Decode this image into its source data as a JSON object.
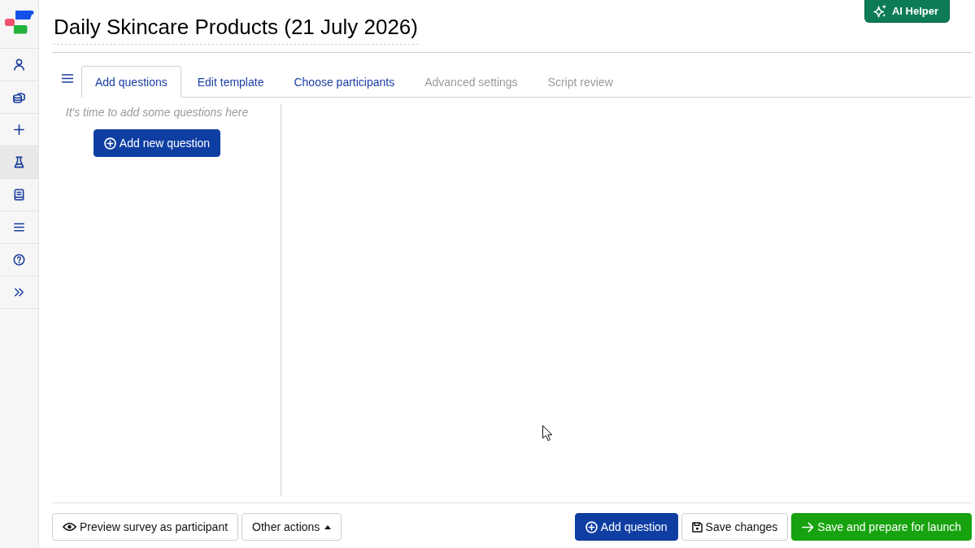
{
  "sidebar": {
    "items": [
      {
        "kind": "user",
        "selected": false
      },
      {
        "kind": "coins",
        "selected": false
      },
      {
        "kind": "add",
        "selected": false
      },
      {
        "kind": "lab",
        "selected": true
      },
      {
        "kind": "book",
        "selected": false
      },
      {
        "kind": "list",
        "selected": false
      },
      {
        "kind": "help",
        "selected": false
      },
      {
        "kind": "expand",
        "selected": false
      }
    ]
  },
  "header": {
    "title": "Daily Skincare Products (21 July 2026)",
    "ai_button": {
      "label": "AI Helper"
    }
  },
  "tabs": [
    {
      "label": "Add questions",
      "selected": true,
      "disabled": false
    },
    {
      "label": "Edit template",
      "selected": false,
      "disabled": false
    },
    {
      "label": "Choose participants",
      "selected": false,
      "disabled": false
    },
    {
      "label": "Advanced settings",
      "selected": false,
      "disabled": true
    },
    {
      "label": "Script review",
      "selected": false,
      "disabled": true
    }
  ],
  "question_panel": {
    "empty_message": "It's time to add some questions here",
    "add_button": {
      "label": "Add new question"
    }
  },
  "footer": {
    "preview_button": {
      "label": "Preview survey as participant"
    },
    "other_actions_button": {
      "label": "Other actions"
    },
    "add_question_button": {
      "label": "Add question"
    },
    "save_button": {
      "label": "Save changes"
    },
    "launch_button": {
      "label": "Save and prepare for launch"
    }
  }
}
